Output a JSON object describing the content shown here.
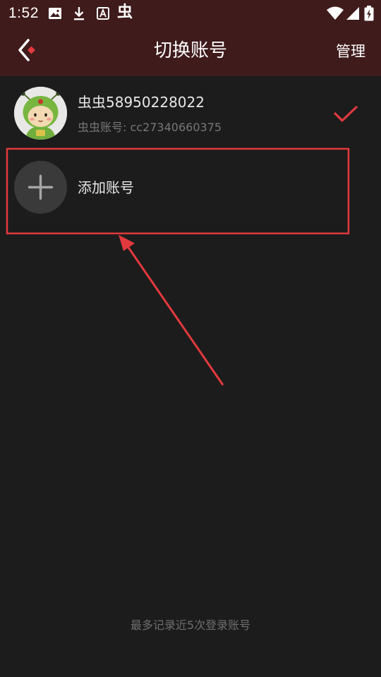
{
  "status_bar": {
    "time": "1:52",
    "app_glyph": "虫",
    "left_icons": [
      "image-icon",
      "download-icon",
      "font-a-icon",
      "bug-app-icon"
    ],
    "right_icons": [
      "wifi-icon",
      "cell-signal-icon",
      "battery-charging-icon"
    ]
  },
  "header": {
    "title": "切换账号",
    "back_icon": "chevron-left-icon",
    "manage_label": "管理"
  },
  "account": {
    "name": "虫虫58950228022",
    "id_text": "虫虫账号: cc27340660375",
    "selected": true
  },
  "add_account": {
    "label": "添加账号"
  },
  "footer": {
    "note": "最多记录近5次登录账号"
  },
  "colors": {
    "status_bar_bg": "#3f1b1c",
    "page_bg": "#1c1c1c",
    "accent_red": "#e03a3e",
    "annotation_red": "#e2393d"
  }
}
